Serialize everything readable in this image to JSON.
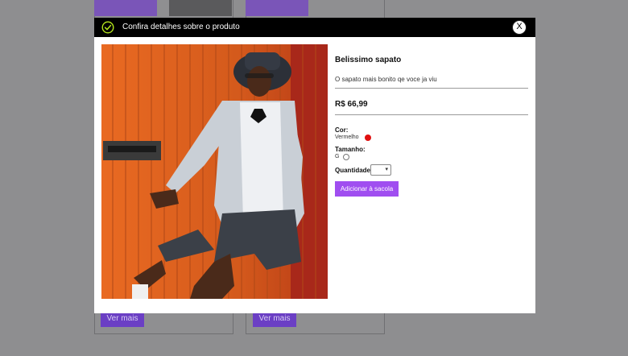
{
  "background": {
    "cards": [
      {
        "button_label": "Ver mais"
      },
      {
        "button_label": "Ver mais"
      }
    ]
  },
  "modal": {
    "title": "Confira detalhes sobre o produto",
    "close_label": "X",
    "product": {
      "name": "Belissimo sapato",
      "description": "O sapato mais bonito qe voce ja viu",
      "price": "R$ 66,99",
      "color_label": "Cor:",
      "color_value": "Vermelho",
      "color_hex": "#e01010",
      "size_label": "Tamanho:",
      "size_value": "G",
      "quantity_label": "Quantidade",
      "quantity_value": "",
      "add_button_label": "Adicionar à sacola"
    }
  },
  "colors": {
    "accent": "#a04ef0",
    "header_bg": "#000000",
    "check_green": "#b5e61d",
    "overlay": "#8e8e90"
  }
}
